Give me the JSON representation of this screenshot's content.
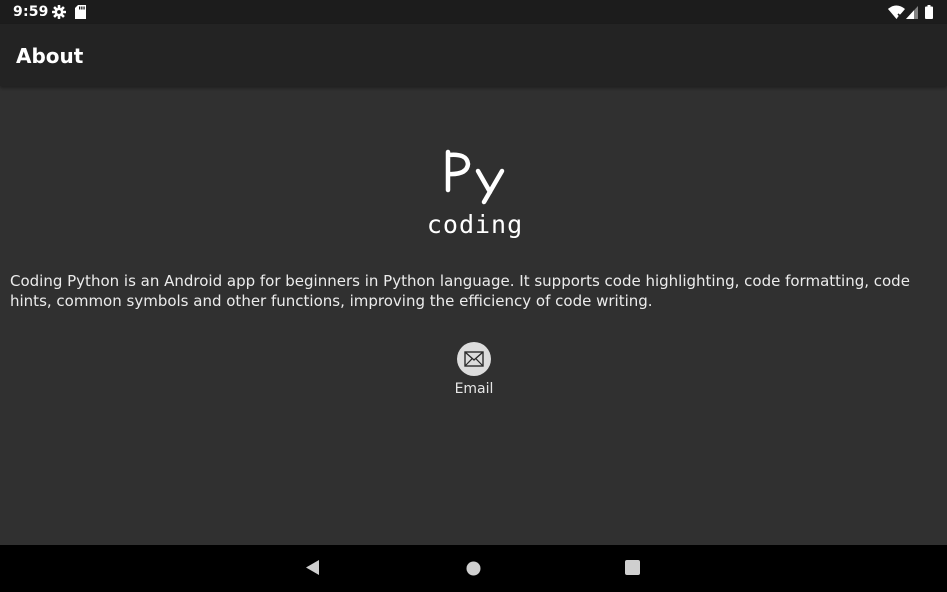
{
  "status_bar": {
    "time": "9:59",
    "left_icons": [
      "gear-icon",
      "sd-card-icon"
    ],
    "right_icons": [
      "wifi-icon",
      "signal-icon",
      "battery-icon"
    ]
  },
  "app_bar": {
    "title": "About"
  },
  "logo": {
    "mark": "Py",
    "subtitle": "coding"
  },
  "description": "Coding Python is an Android app for beginners in Python language. It supports code highlighting, code formatting, code hints, common symbols and other functions, improving the efficiency of code writing.",
  "contact": {
    "email_label": "Email",
    "icon": "envelope-icon"
  },
  "navigation_bar": {
    "buttons": [
      "back-icon",
      "home-icon",
      "recents-icon"
    ]
  },
  "colors": {
    "background": "#303030",
    "app_bar": "#232323",
    "status_bar": "#1c1c1c",
    "nav_bar": "#000000",
    "text": "#ffffff"
  }
}
